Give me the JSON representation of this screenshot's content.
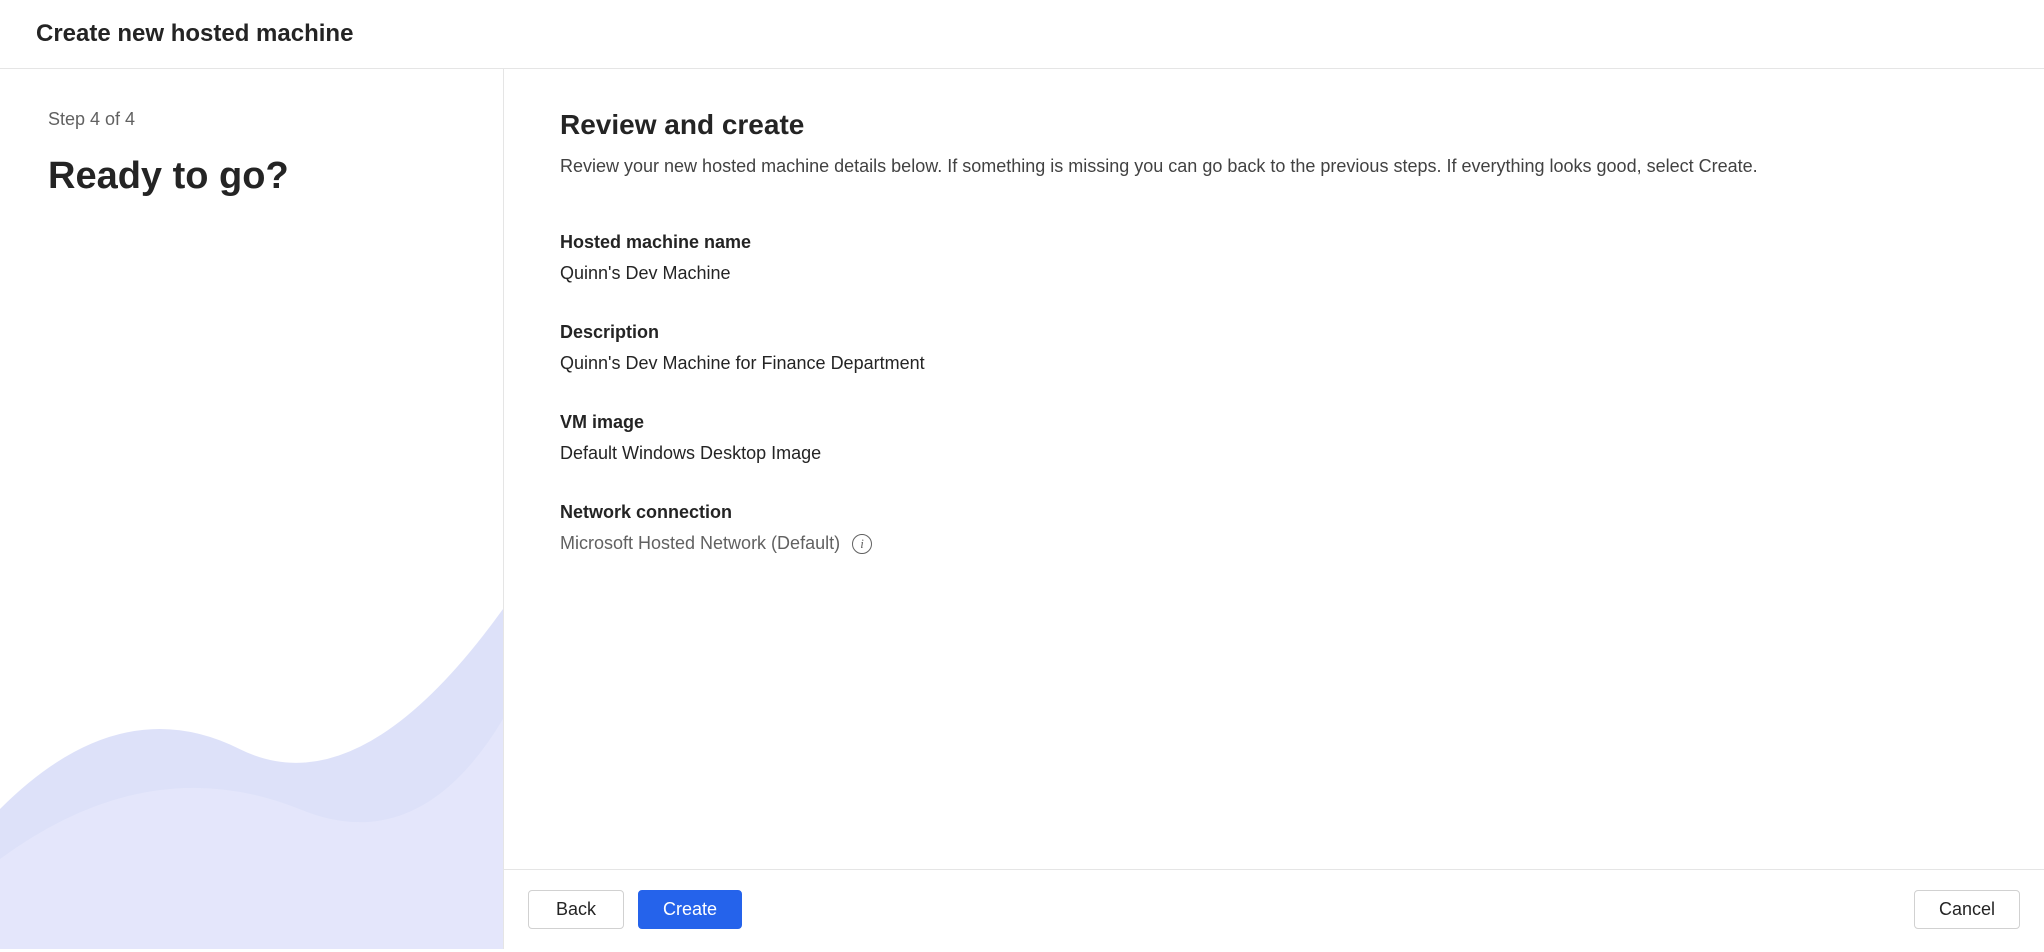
{
  "header": {
    "title": "Create new hosted machine"
  },
  "sidebar": {
    "step": "Step 4 of 4",
    "heading": "Ready to go?"
  },
  "main": {
    "title": "Review and create",
    "description": "Review your new hosted machine details below. If something is missing you can go back to the previous steps. If everything looks good, select Create.",
    "details": {
      "machine_name_label": "Hosted machine name",
      "machine_name_value": "Quinn's Dev Machine",
      "description_label": "Description",
      "description_value": "Quinn's Dev Machine for Finance Department",
      "vm_image_label": "VM image",
      "vm_image_value": "Default Windows Desktop Image",
      "network_label": "Network connection",
      "network_value": "Microsoft Hosted Network (Default)"
    }
  },
  "footer": {
    "back": "Back",
    "create": "Create",
    "cancel": "Cancel"
  }
}
